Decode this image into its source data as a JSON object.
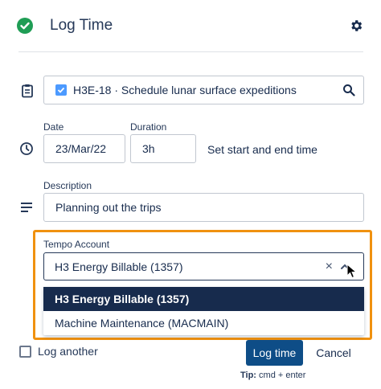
{
  "header": {
    "title": "Log Time",
    "status_icon": "check-circle-icon",
    "settings_icon": "gear-icon"
  },
  "issue": {
    "text": "H3E-18 · Schedule lunar surface expeditions",
    "icon": "clipboard-icon",
    "search_icon": "search-icon"
  },
  "date": {
    "label": "Date",
    "value": "23/Mar/22"
  },
  "duration": {
    "label": "Duration",
    "value": "3h"
  },
  "time_link": "Set start and end time",
  "description": {
    "label": "Description",
    "value": "Planning out the trips"
  },
  "tempo": {
    "label": "Tempo Account",
    "selected": "H3 Energy Billable (1357)",
    "clear_glyph": "×",
    "options": [
      {
        "label": "H3 Energy Billable (1357)",
        "selected": true
      },
      {
        "label": "Machine Maintenance (MACMAIN)",
        "selected": false
      }
    ]
  },
  "footer": {
    "log_another": "Log another",
    "log_time_button": "Log time",
    "cancel_button": "Cancel",
    "tip_label": "Tip:",
    "tip_text": " cmd + enter"
  },
  "colors": {
    "accent": "#0e4d87",
    "highlight_border": "#f0910f",
    "success": "#1f9d55",
    "checkbox": "#4c9aff",
    "option_selected": "#172b4d"
  }
}
